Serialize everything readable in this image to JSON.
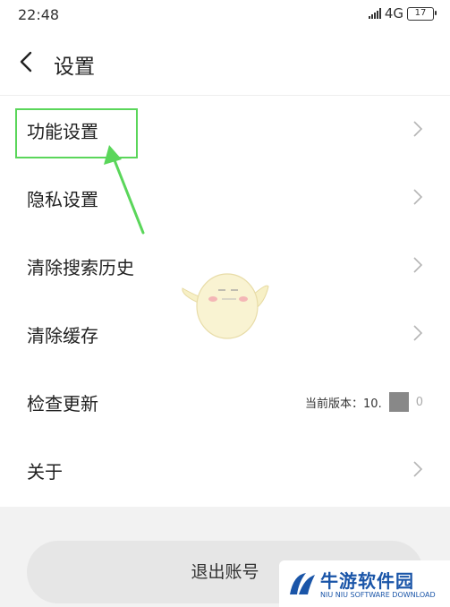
{
  "status_bar": {
    "time": "22:48",
    "network": "4G",
    "battery": "17"
  },
  "header": {
    "title": "设置"
  },
  "settings": {
    "items": [
      {
        "label": "功能设置"
      },
      {
        "label": "隐私设置"
      },
      {
        "label": "清除搜索历史"
      },
      {
        "label": "清除缓存"
      },
      {
        "label": "检查更新",
        "version_label": "当前版本：10.",
        "version_suffix": "0"
      },
      {
        "label": "关于"
      }
    ]
  },
  "logout_label": "退出账号",
  "watermark": {
    "name": "牛游软件园",
    "sub": "NIU NIU SOFTWARE DOWNLOAD"
  },
  "colors": {
    "highlight": "#5ad65a",
    "watermark": "#1a55a8"
  }
}
